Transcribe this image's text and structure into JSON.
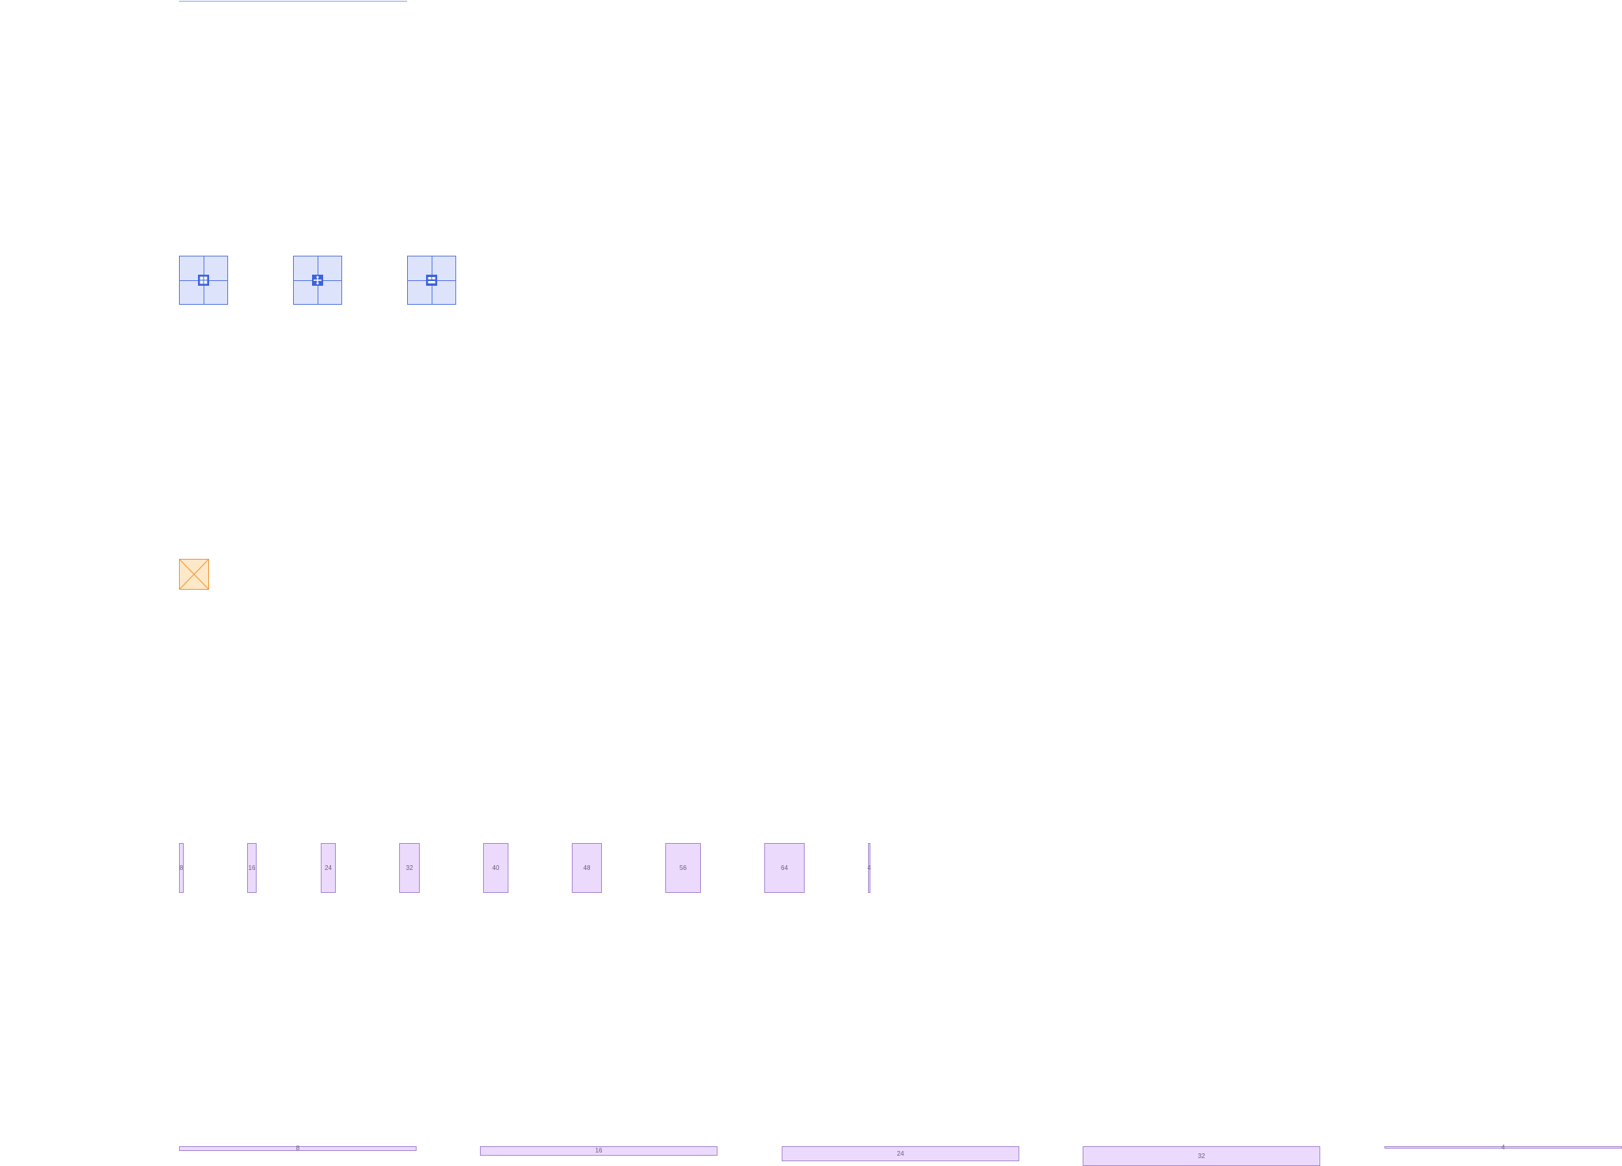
{
  "diagram": {
    "colors": {
      "grid_fill": "#dde3fb",
      "grid_stroke": "#5b7be0",
      "icon_fill": "#3d63dd",
      "placeholder_fill": "#fde8c8",
      "placeholder_stroke": "#f0973a",
      "spacer_fill": "#ecdafc",
      "spacer_stroke": "#a88bd1",
      "label_color": "#6b5a86"
    },
    "grid_tiles": [
      {
        "icon": "grid-4-icon"
      },
      {
        "icon": "grid-move-icon"
      },
      {
        "icon": "grid-split-icon"
      }
    ],
    "placeholder": {
      "icon": "placeholder-x-icon"
    },
    "vertical_spacers": [
      {
        "label": "8"
      },
      {
        "label": "16"
      },
      {
        "label": "24"
      },
      {
        "label": "32"
      },
      {
        "label": "40"
      },
      {
        "label": "48"
      },
      {
        "label": "56"
      },
      {
        "label": "64"
      },
      {
        "label": "4"
      }
    ],
    "horizontal_spacers": [
      {
        "label": "8"
      },
      {
        "label": "16"
      },
      {
        "label": "24"
      },
      {
        "label": "32"
      },
      {
        "label": "4"
      }
    ]
  }
}
